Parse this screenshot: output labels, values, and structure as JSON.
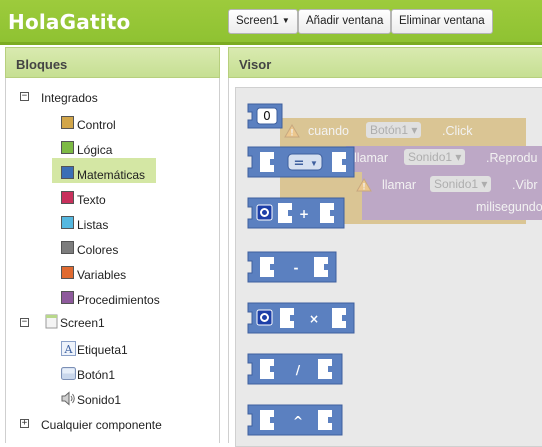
{
  "app_title": "HolaGatito",
  "toolbar": {
    "screen_dropdown": "Screen1",
    "add_screen": "Añadir ventana",
    "remove_screen": "Eliminar ventana"
  },
  "blocks_panel": {
    "title": "Bloques",
    "builtin": {
      "label": "Integrados",
      "toggle": "−",
      "categories": [
        {
          "label": "Control",
          "color": "#d2a64a"
        },
        {
          "label": "Lógica",
          "color": "#7dba44"
        },
        {
          "label": "Matemáticas",
          "color": "#3b6fb6"
        },
        {
          "label": "Texto",
          "color": "#c8305c"
        },
        {
          "label": "Listas",
          "color": "#55b8e0"
        },
        {
          "label": "Colores",
          "color": "#7d7d7d"
        },
        {
          "label": "Variables",
          "color": "#e06a30"
        },
        {
          "label": "Procedimientos",
          "color": "#8e5a9c"
        }
      ]
    },
    "screen": {
      "label": "Screen1",
      "toggle": "−",
      "components": [
        {
          "label": "Etiqueta1",
          "icon": "label-icon"
        },
        {
          "label": "Botón1",
          "icon": "button-icon"
        },
        {
          "label": "Sonido1",
          "icon": "sound-icon"
        }
      ]
    },
    "any_component": {
      "label": "Cualquier componente",
      "toggle": "+"
    }
  },
  "viewer": {
    "title": "Visor",
    "ghost_blocks": {
      "when": "cuando",
      "component": "Botón1",
      "event": ".Click",
      "call1": "llamar",
      "sound": "Sonido1",
      "method1": ".Reprodu",
      "call2": "llamar",
      "sound2": "Sonido1",
      "method2": ".Vibr",
      "param": "milisegundo"
    },
    "math_blocks": {
      "number": "0",
      "compare_op": "=",
      "add_op": "+",
      "subtract_op": "-",
      "multiply_op": "×",
      "divide_op": "/",
      "power_op": "^"
    },
    "colors": {
      "math_block": "#5b80c0",
      "math_dark": "#3e5f9e",
      "warning": "#f0a020"
    }
  }
}
